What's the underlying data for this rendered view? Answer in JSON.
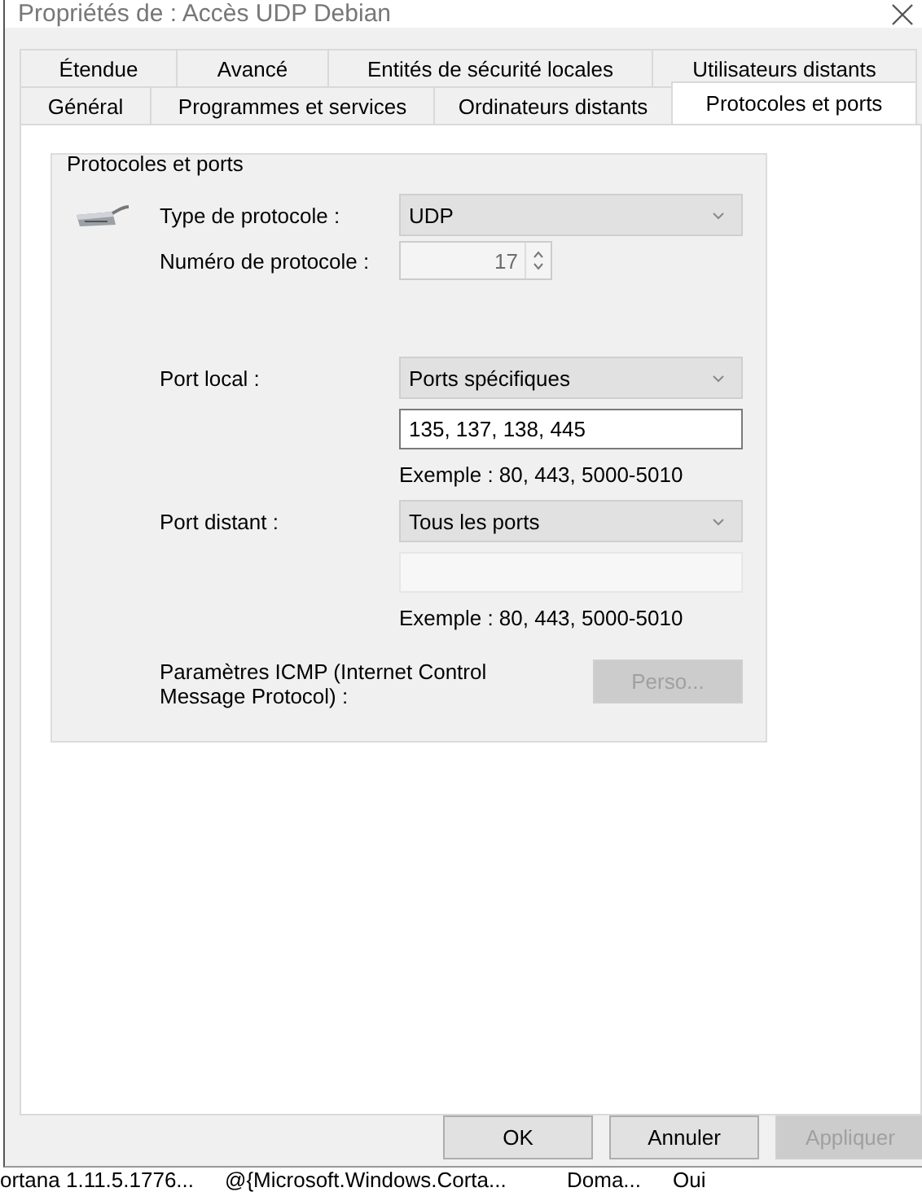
{
  "window": {
    "title": "Propriétés de : Accès UDP Debian"
  },
  "tab_rows": [
    [
      {
        "label": "Étendue",
        "selected": false
      },
      {
        "label": "Avancé",
        "selected": false
      },
      {
        "label": "Entités de sécurité locales",
        "selected": false
      },
      {
        "label": "Utilisateurs distants",
        "selected": false
      }
    ],
    [
      {
        "label": "Général",
        "selected": false
      },
      {
        "label": "Programmes et services",
        "selected": false
      },
      {
        "label": "Ordinateurs distants",
        "selected": false
      },
      {
        "label": "Protocoles et ports",
        "selected": true
      }
    ]
  ],
  "group": {
    "title": "Protocoles et ports",
    "protocol_type": {
      "label": "Type de protocole :",
      "value": "UDP"
    },
    "protocol_number": {
      "label": "Numéro de protocole :",
      "value": "17",
      "disabled": true
    },
    "local_port": {
      "label": "Port local :",
      "value": "Ports spécifiques",
      "ports": "135, 137, 138, 445",
      "ports_disabled": false,
      "example": "Exemple : 80, 443, 5000-5010"
    },
    "remote_port": {
      "label": "Port distant :",
      "value": "Tous les ports",
      "ports_disabled": true,
      "example": "Exemple : 80, 443, 5000-5010"
    },
    "icmp": {
      "label": "Paramètres ICMP (Internet Control Message Protocol) :",
      "button": "Perso...",
      "disabled": true
    }
  },
  "buttons": [
    {
      "label": "OK",
      "disabled": false
    },
    {
      "label": "Annuler",
      "disabled": false
    },
    {
      "label": "Appliquer",
      "disabled": true
    }
  ],
  "background_row": [
    "ortana  1.11.5.1776...",
    "@{Microsoft.Windows.Corta...",
    "Doma...",
    "Oui"
  ]
}
